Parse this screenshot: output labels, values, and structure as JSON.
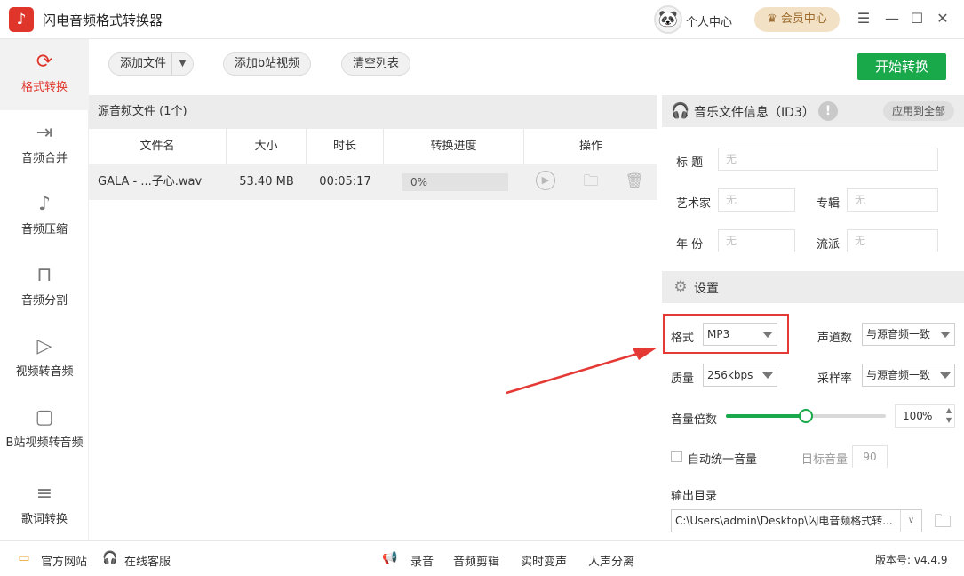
{
  "app": {
    "title": "闪电音频格式转换器",
    "logo_glyph": "♪",
    "personal_center": "个人中心",
    "vip_center": "♛ 会员中心"
  },
  "window_controls": {
    "menu": "☰",
    "minimize": "—",
    "maximize": "☐",
    "close": "✕"
  },
  "sidebar": {
    "items": [
      {
        "label": "格式转换",
        "icon": "⟳"
      },
      {
        "label": "音频合并",
        "icon": "⇥"
      },
      {
        "label": "音频压缩",
        "icon": "♪"
      },
      {
        "label": "音频分割",
        "icon": "⊓"
      },
      {
        "label": "视频转音频",
        "icon": "▷"
      },
      {
        "label": "B站视频转音频",
        "icon": "▢"
      },
      {
        "label": "歌词转换",
        "icon": "≡"
      }
    ]
  },
  "toolbar": {
    "add_file": "添加文件",
    "add_bilibili": "添加b站视频",
    "clear_list": "清空列表",
    "start": "开始转换"
  },
  "file_list": {
    "header": "源音频文件 (1个)",
    "columns": [
      "文件名",
      "大小",
      "时长",
      "转换进度",
      "操作"
    ],
    "rows": [
      {
        "name": "GALA - ...子心.wav",
        "size": "53.40 MB",
        "duration": "00:05:17",
        "progress": "0%"
      }
    ]
  },
  "id3": {
    "title": "音乐文件信息（ID3）",
    "apply_all": "应用到全部",
    "fields": {
      "title_label": "标 题",
      "artist_label": "艺术家",
      "album_label": "专辑",
      "year_label": "年 份",
      "genre_label": "流派",
      "placeholder": "无"
    }
  },
  "settings": {
    "title": "设置",
    "format_label": "格式",
    "format_value": "MP3",
    "channels_label": "声道数",
    "channels_value": "与源音频一致",
    "quality_label": "质量",
    "quality_value": "256kbps",
    "samplerate_label": "采样率",
    "samplerate_value": "与源音频一致",
    "volume_label": "音量倍数",
    "volume_value": "100",
    "volume_unit": "%",
    "volume_fraction": 0.5,
    "auto_volume_label": "自动统一音量",
    "target_volume_label": "目标音量",
    "target_volume_value": "90",
    "output_label": "输出目录",
    "output_path": "C:\\Users\\admin\\Desktop\\闪电音频格式转..."
  },
  "statusbar": {
    "website": "官方网站",
    "support": "在线客服",
    "record": "录音",
    "edit": "音频剪辑",
    "voice_change": "实时变声",
    "vocal_split": "人声分离",
    "version": "版本号: v4.4.9"
  },
  "colors": {
    "accent_red": "#e0352b",
    "green": "#19a84a",
    "annotation": "#e53935"
  }
}
